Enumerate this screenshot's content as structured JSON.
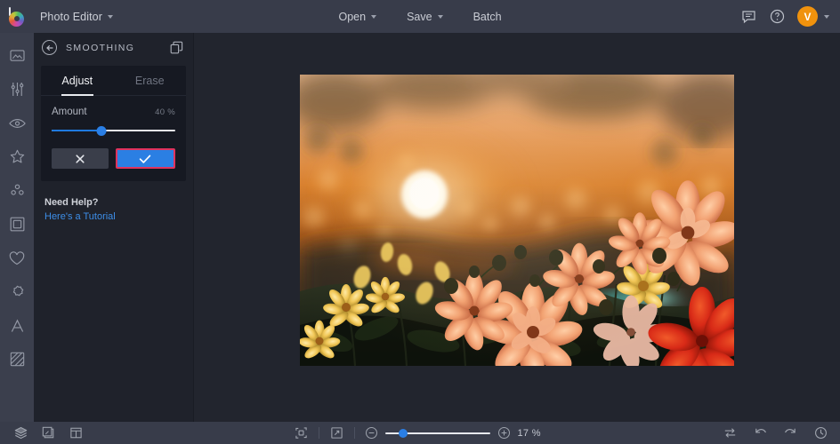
{
  "topbar": {
    "logo_name": "bepic-logo",
    "app_title": "Photo Editor",
    "buttons": [
      {
        "label": "Open",
        "has_caret": true,
        "name": "open-button"
      },
      {
        "label": "Save",
        "has_caret": true,
        "name": "save-button"
      },
      {
        "label": "Batch",
        "has_caret": false,
        "name": "batch-button"
      }
    ],
    "chat_icon": "chat-bubble-icon",
    "help_icon": "help-question-icon",
    "avatar_initial": "V",
    "avatar_color": "#f0920d"
  },
  "rail": {
    "items": [
      {
        "name": "sidebar-item-photo",
        "icon": "image-icon"
      },
      {
        "name": "sidebar-item-adjust",
        "icon": "sliders-icon"
      },
      {
        "name": "sidebar-item-retouch",
        "icon": "eye-icon"
      },
      {
        "name": "sidebar-item-effects",
        "icon": "star-icon"
      },
      {
        "name": "sidebar-item-overlays",
        "icon": "dots-cluster-icon"
      },
      {
        "name": "sidebar-item-frames",
        "icon": "square-frame-icon"
      },
      {
        "name": "sidebar-item-favorites",
        "icon": "heart-icon"
      },
      {
        "name": "sidebar-item-stickers",
        "icon": "badge-icon"
      },
      {
        "name": "sidebar-item-text",
        "icon": "text-a-icon"
      },
      {
        "name": "sidebar-item-texture",
        "icon": "hatched-square-icon"
      }
    ]
  },
  "panel": {
    "back_icon": "back-arrow-circle-icon",
    "title": "SMOOTHING",
    "copy_icon": "duplicate-layers-icon",
    "tabs": [
      {
        "label": "Adjust",
        "active": true,
        "name": "tab-adjust"
      },
      {
        "label": "Erase",
        "active": false,
        "name": "tab-erase"
      }
    ],
    "slider": {
      "label": "Amount",
      "value_text": "40 %",
      "value": 40,
      "min": 0,
      "max": 100,
      "fill_color": "#1f7ae0",
      "track_color": "#e7e9ee"
    },
    "cancel_icon": "close-x-icon",
    "apply_icon": "check-icon",
    "apply_highlight_color": "#e0335e",
    "help_question": "Need Help?",
    "help_link": "Here's a Tutorial",
    "help_link_color": "#3d8ee8"
  },
  "canvas": {
    "image_description": "sunset-dahlia-flowers-photo"
  },
  "bottombar": {
    "left_icons": [
      {
        "name": "layers-icon"
      },
      {
        "name": "compare-split-icon"
      },
      {
        "name": "layout-grid-icon"
      }
    ],
    "center_icons": [
      {
        "name": "fit-to-screen-icon"
      },
      {
        "name": "fullscreen-expand-icon"
      }
    ],
    "zoom_out_icon": "minus-icon",
    "zoom_in_icon": "plus-icon",
    "zoom_percent": "17 %",
    "zoom_value": 17,
    "right_icons": [
      {
        "name": "toggle-before-after-icon"
      },
      {
        "name": "undo-icon"
      },
      {
        "name": "redo-icon"
      },
      {
        "name": "history-clock-icon"
      }
    ]
  }
}
